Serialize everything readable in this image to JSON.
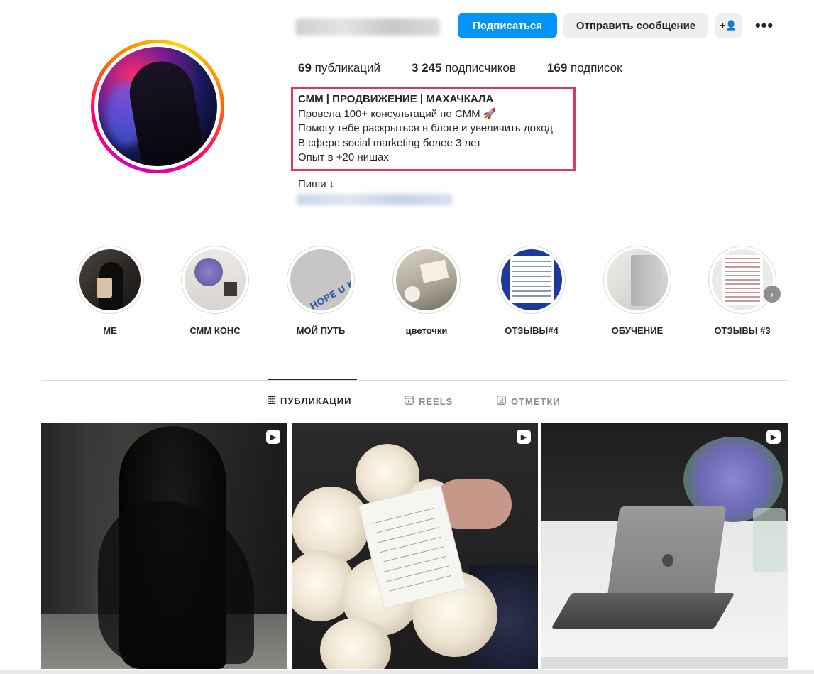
{
  "profile": {
    "username_blurred": "",
    "follow_label": "Подписаться",
    "message_label": "Отправить сообщение",
    "add_user_label": "+👤",
    "more_label": "•••"
  },
  "stats": {
    "posts_count": "69",
    "posts_label": "публикаций",
    "followers_count": "3 245",
    "followers_label": "подписчиков",
    "following_count": "169",
    "following_label": "подписок"
  },
  "bio": {
    "name": "СММ | ПРОДВИЖЕНИЕ | МАХАЧКАЛА",
    "line1": "Провела 100+ консультаций по СММ 🚀",
    "line2": "Помогу тебе раскрыться в блоге и увеличить доход",
    "line3": "В сфере social marketing более 3 лет",
    "line4": "Опыт в +20 нишах",
    "cta": "Пиши ↓",
    "highlight_color": "#e0375c"
  },
  "highlights": [
    {
      "label": "МЕ"
    },
    {
      "label": "СММ КОНС"
    },
    {
      "label": "МОЙ ПУТЬ",
      "image_text": "I HOPE U KN HOW LOVED U"
    },
    {
      "label": "цветочки"
    },
    {
      "label": "ОТЗЫВЫ#4"
    },
    {
      "label": "ОБУЧЕНИЕ"
    },
    {
      "label": "ОТЗЫВЫ #3"
    }
  ],
  "tabs": [
    {
      "label": "ПУБЛИКАЦИИ",
      "icon": "grid-icon",
      "active": true
    },
    {
      "label": "REELS",
      "icon": "reels-icon",
      "active": false
    },
    {
      "label": "ОТМЕТКИ",
      "icon": "tagged-icon",
      "active": false
    }
  ],
  "colors": {
    "primary_button": "#0095f6",
    "secondary_button": "#efefef",
    "text": "#262626",
    "muted": "#8e8e8e"
  }
}
